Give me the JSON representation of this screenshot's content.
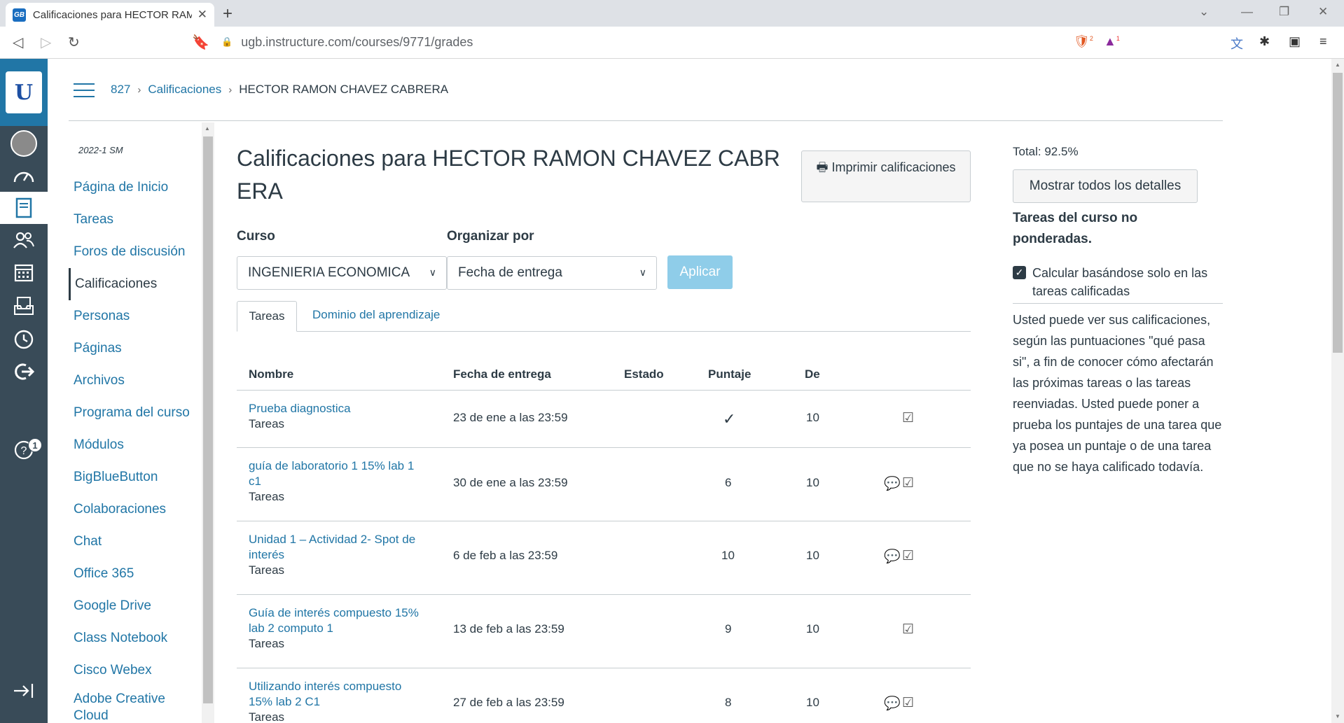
{
  "browser": {
    "tab_title": "Calificaciones para HECTOR RAMON CHAVEZ CABRERA",
    "favicon_text": "GB",
    "url": "ugb.instructure.com/courses/9771/grades",
    "brave_badge": "2",
    "alert_badge": "1"
  },
  "breadcrumb": {
    "course": "827",
    "section": "Calificaciones",
    "current": "HECTOR RAMON CHAVEZ CABRERA"
  },
  "global_nav": {
    "help_badge": "1"
  },
  "course_nav": {
    "term": "2022-1 SM",
    "items": [
      {
        "label": "Página de Inicio"
      },
      {
        "label": "Tareas"
      },
      {
        "label": "Foros de discusión"
      },
      {
        "label": "Calificaciones"
      },
      {
        "label": "Personas"
      },
      {
        "label": "Páginas"
      },
      {
        "label": "Archivos"
      },
      {
        "label": "Programa del curso"
      },
      {
        "label": "Módulos"
      },
      {
        "label": "BigBlueButton"
      },
      {
        "label": "Colaboraciones"
      },
      {
        "label": "Chat"
      },
      {
        "label": "Office 365"
      },
      {
        "label": "Google Drive"
      },
      {
        "label": "Class Notebook"
      },
      {
        "label": "Cisco Webex"
      },
      {
        "label": "Adobe Creative Cloud"
      }
    ]
  },
  "main": {
    "title": "Calificaciones para HECTOR RAMON CHAVEZ CABRERA",
    "print_label": "Imprimir calificaciones",
    "course_label": "Curso",
    "course_value": "INGENIERIA ECONOMICA",
    "arrange_label": "Organizar por",
    "arrange_value": "Fecha de entrega",
    "apply_label": "Aplicar",
    "tabs": [
      {
        "label": "Tareas"
      },
      {
        "label": "Dominio del aprendizaje"
      }
    ],
    "table": {
      "headers": [
        "Nombre",
        "Fecha de entrega",
        "Estado",
        "Puntaje",
        "De"
      ],
      "rows": [
        {
          "name": "Prueba diagnostica",
          "group": "Tareas",
          "due": "23 de ene a las 23:59",
          "score": "✓",
          "out_of": "10"
        },
        {
          "name": "guía de laboratorio 1 15% lab 1 c1",
          "group": "Tareas",
          "due": "30 de ene a las 23:59",
          "score": "6",
          "out_of": "10"
        },
        {
          "name": "Unidad 1 – Actividad 2- Spot de interés",
          "group": "Tareas",
          "due": "6 de feb a las 23:59",
          "score": "10",
          "out_of": "10"
        },
        {
          "name": "Guía de interés compuesto 15% lab 2 computo 1",
          "group": "Tareas",
          "due": "13 de feb a las 23:59",
          "score": "9",
          "out_of": "10"
        },
        {
          "name": "Utilizando interés compuesto 15% lab 2 C1",
          "group": "Tareas",
          "due": "27 de feb a las 23:59",
          "score": "8",
          "out_of": "10"
        }
      ]
    }
  },
  "sidebar": {
    "total": "Total: 92.5%",
    "details_label": "Mostrar todos los detalles",
    "unweighted": "Tareas del curso no ponderadas.",
    "checkbox_label": "Calcular basándose solo en las tareas calificadas",
    "description": "Usted puede ver sus calificaciones, según las puntuaciones \"qué pasa si\", a fin de conocer cómo afectarán las próximas tareas o las tareas reenviadas. Usted puede poner a prueba los puntajes de una tarea que ya posea un puntaje o de una tarea que no se haya calificado todavía."
  }
}
